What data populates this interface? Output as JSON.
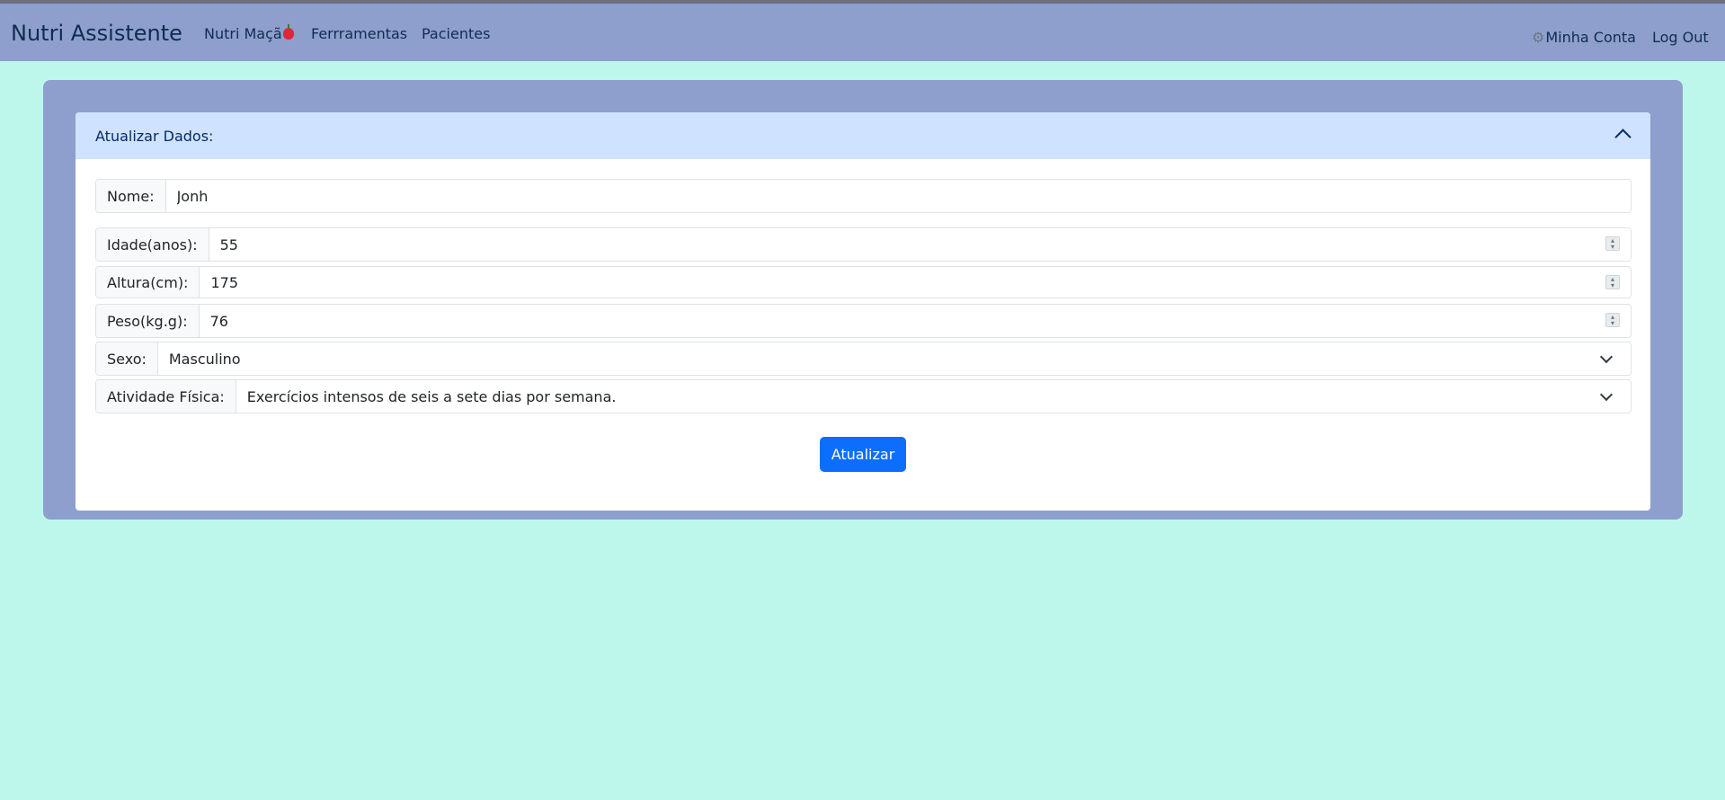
{
  "navbar": {
    "brand": "Nutri Assistente",
    "links": [
      {
        "label": "Nutri Maçã"
      },
      {
        "label": "Ferrramentas"
      },
      {
        "label": "Pacientes"
      }
    ],
    "account_label": "Minha Conta",
    "logout_label": "Log Out"
  },
  "card": {
    "title": "Atualizar Dados:",
    "fields": {
      "nome": {
        "label": "Nome:",
        "value": "Jonh"
      },
      "idade": {
        "label": "Idade(anos):",
        "value": "55"
      },
      "altura": {
        "label": "Altura(cm):",
        "value": "175"
      },
      "peso": {
        "label": "Peso(kg.g):",
        "value": "76"
      },
      "sexo": {
        "label": "Sexo:",
        "value": "Masculino"
      },
      "atividade": {
        "label": "Atividade Física:",
        "value": "Exercícios intensos de seis a sete dias por semana."
      }
    },
    "submit_label": "Atualizar"
  },
  "colors": {
    "page_background": "#bdf7ec",
    "navbar": "#8e9fce",
    "card_header": "#cfe2ff",
    "primary": "#0d6efd"
  },
  "icons": {
    "apple": "apple-icon",
    "gear": "gear-icon",
    "collapse": "chevron-up-icon",
    "dropdown": "chevron-down-icon",
    "spinner": "number-spinner-icon"
  }
}
